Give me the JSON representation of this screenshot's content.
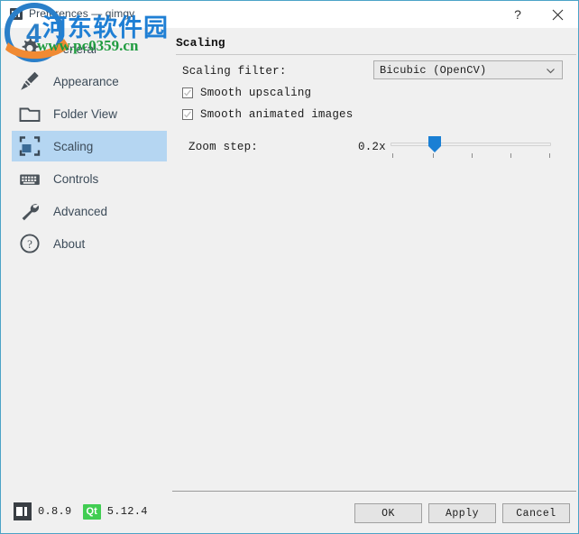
{
  "window": {
    "title": "Preferences — qimgv",
    "icon": "app-window-icon",
    "help_label": "?",
    "close_label": "✕",
    "border_color": "#4ba3c7"
  },
  "sidebar": {
    "items": [
      {
        "label": "General",
        "icon": "gear-icon",
        "selected": false
      },
      {
        "label": "Appearance",
        "icon": "brush-icon",
        "selected": false
      },
      {
        "label": "Folder View",
        "icon": "folder-icon",
        "selected": false
      },
      {
        "label": "Scaling",
        "icon": "scaling-icon",
        "selected": true
      },
      {
        "label": "Controls",
        "icon": "keyboard-icon",
        "selected": false
      },
      {
        "label": "Advanced",
        "icon": "wrench-icon",
        "selected": false
      },
      {
        "label": "About",
        "icon": "question-icon",
        "selected": false
      }
    ],
    "selection_color": "#b5d6f2"
  },
  "panel": {
    "title": "Scaling",
    "scaling_filter": {
      "label": "Scaling filter:",
      "selected": "Bicubic (OpenCV)",
      "options": [
        "Bicubic (OpenCV)"
      ]
    },
    "smooth_upscaling": {
      "label": "Smooth upscaling",
      "checked": true
    },
    "smooth_animated": {
      "label": "Smooth animated images",
      "checked": true
    },
    "zoom_step": {
      "label": "Zoom step:",
      "value": "0.2x",
      "handle_position_pct": 25,
      "tick_count": 5,
      "accent_color": "#1a7fd4"
    }
  },
  "footer": {
    "app_version": "0.8.9",
    "qt_badge": "Qt",
    "qt_version": "5.12.4",
    "qt_color": "#41cd52",
    "buttons": {
      "ok": "OK",
      "apply": "Apply",
      "cancel": "Cancel"
    }
  },
  "watermark": {
    "chinese": "河东软件园",
    "url": "www.pc0359.cn"
  }
}
